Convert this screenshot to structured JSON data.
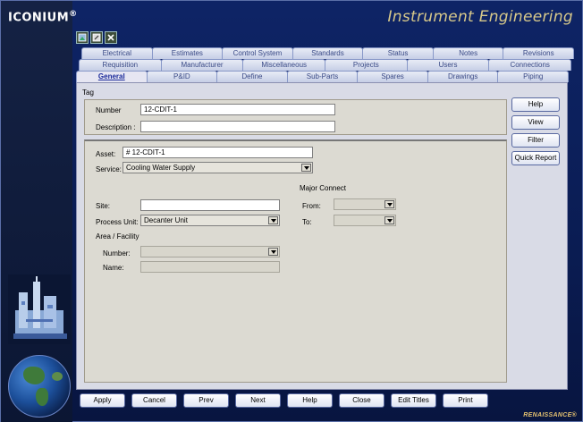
{
  "app": {
    "logo": "ICONIUM",
    "logo_mark": "®",
    "title": "Instrument Engineering",
    "brand": "RENAISSANCE®"
  },
  "tabs": {
    "row1": [
      "Electrical",
      "Estimates",
      "Control System",
      "Standards",
      "Status",
      "Notes",
      "Revisions"
    ],
    "row2": [
      "Requisition",
      "Manufacturer",
      "Miscellaneous",
      "Projects",
      "Users",
      "Connections"
    ],
    "row3": [
      "General",
      "P&ID",
      "Define",
      "Sub-Parts",
      "Spares",
      "Drawings",
      "Piping"
    ],
    "active": "General"
  },
  "tag": {
    "section": "Tag",
    "number_label": "Number",
    "number_value": "12-CDIT-1",
    "description_label": "Description :",
    "description_value": ""
  },
  "asset": {
    "asset_label": "Asset:",
    "asset_value": "# 12-CDIT-1",
    "service_label": "Service:",
    "service_value": "Cooling Water Supply",
    "site_label": "Site:",
    "site_value": "",
    "process_unit_label": "Process Unit:",
    "process_unit_value": "Decanter Unit",
    "area_facility_label": "Area / Facility",
    "area_number_label": "Number:",
    "area_name_label": "Name:",
    "major_connect_label": "Major Connect",
    "from_label": "From:",
    "to_label": "To:"
  },
  "side_buttons": [
    "Help",
    "View",
    "Filter",
    "Quick Report"
  ],
  "bottom_buttons": [
    "Apply",
    "Cancel",
    "Prev",
    "Next",
    "Help",
    "Close",
    "Edit Titles",
    "Print"
  ],
  "colors": {
    "frame_bg": "#0e2466",
    "title_gold": "#d8c98a",
    "panel_bg": "#d9dbe6",
    "brand": "#e5c270"
  }
}
